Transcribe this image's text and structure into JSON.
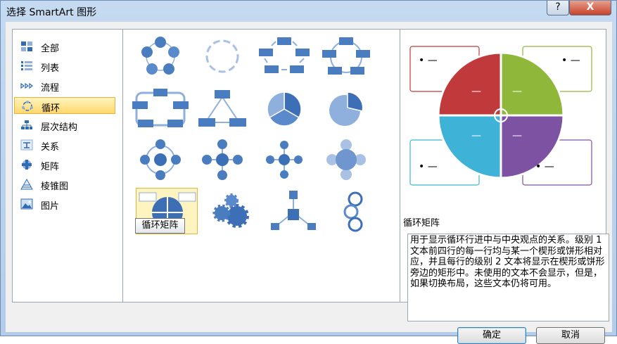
{
  "window": {
    "title": "选择 SmartArt 图形",
    "help_label": "?",
    "close_label": "X"
  },
  "categories": [
    {
      "label": "全部",
      "icon": "grid-all-icon"
    },
    {
      "label": "列表",
      "icon": "list-icon"
    },
    {
      "label": "流程",
      "icon": "process-arrows-icon"
    },
    {
      "label": "循环",
      "icon": "cycle-icon",
      "selected": true
    },
    {
      "label": "层次结构",
      "icon": "hierarchy-icon"
    },
    {
      "label": "关系",
      "icon": "relationship-icon"
    },
    {
      "label": "矩阵",
      "icon": "matrix-icon"
    },
    {
      "label": "棱锥图",
      "icon": "pyramid-icon"
    },
    {
      "label": "图片",
      "icon": "picture-icon"
    }
  ],
  "gallery": {
    "selected_index": 12,
    "tooltip": "循环矩阵"
  },
  "preview": {
    "title": "循环矩阵",
    "bullet_text": "• —",
    "quadrant_text": "—",
    "quadrant_colors": [
      "#c0393b",
      "#8fb83a",
      "#3fb3d7",
      "#7d52a3"
    ],
    "description": "用于显示循环行进中与中央观点的关系。级别 1 文本前四行的每一行均与某一个楔形或饼形相对应，并且每行的级别 2 文本将显示在楔形或饼形旁边的矩形中。未使用的文本不会显示，但是，如果切换布局，这些文本仍将可用。"
  },
  "buttons": {
    "ok": "确定",
    "cancel": "取消"
  },
  "colors": {
    "accent_blue": "#3d6fb6",
    "light_blue": "#8fb0dc",
    "selection_fill": "#fff3c0",
    "selection_border": "#e2b53b"
  }
}
